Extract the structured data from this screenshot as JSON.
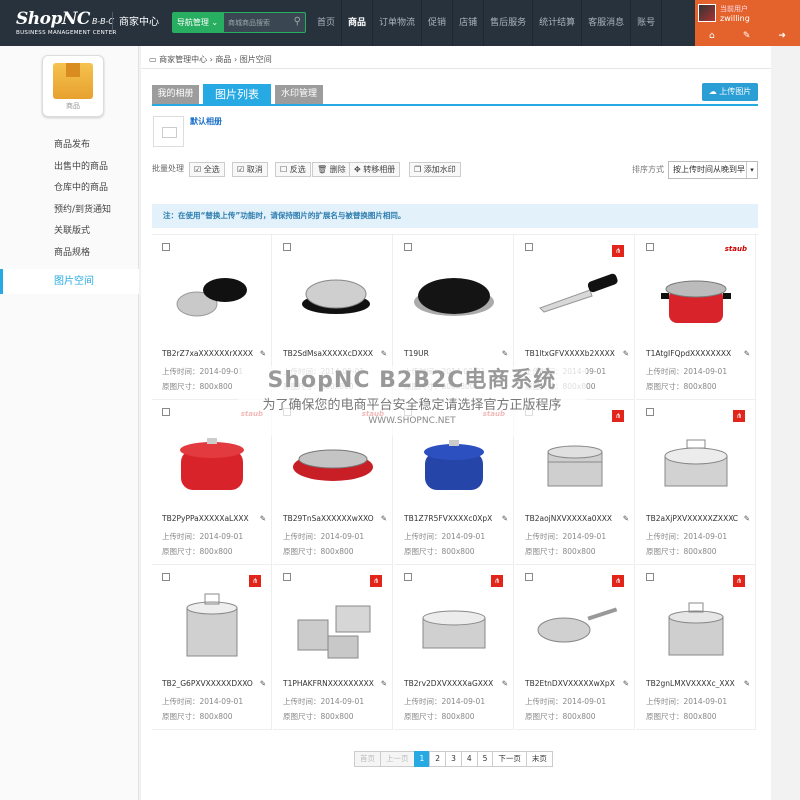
{
  "header": {
    "logo": {
      "brand": "ShopNC",
      "edition": "B-B-C",
      "tagline": "BUSINESS MANAGEMENT CENTER"
    },
    "center_title": "商家中心",
    "nav_button": "导航管理",
    "search_placeholder": "商城商品搜索",
    "nav_items": [
      "首页",
      "商品",
      "订单物流",
      "促销",
      "店铺",
      "售后服务",
      "统计结算",
      "客服消息",
      "账号"
    ],
    "user": {
      "role": "当前用户",
      "name": "zwilling",
      "icons": [
        "home-icon",
        "wrench-icon",
        "logout-icon"
      ]
    }
  },
  "sidebar": {
    "module_label": "商品",
    "items": [
      "商品发布",
      "出售中的商品",
      "仓库中的商品",
      "预约/到货通知",
      "关联版式",
      "商品规格",
      "图片空间"
    ],
    "active_index": 6
  },
  "breadcrumb": [
    "商家管理中心",
    "商品",
    "图片空间"
  ],
  "tabs": [
    "我的相册",
    "图片列表",
    "水印管理"
  ],
  "active_tab": 1,
  "upload_button": "上传图片",
  "album": {
    "name": "默认相册"
  },
  "batch": {
    "label": "批量处理",
    "buttons": [
      "全选",
      "取消",
      "反选",
      "删除",
      "转移相册",
      "添加水印"
    ]
  },
  "sort": {
    "label": "排序方式",
    "selected": "按上传时间从晚到早"
  },
  "notice": "注：在使用“替换上传”功能时，请保持图片的扩展名与被替换图片相同。",
  "photos": [
    {
      "name": "TB2rZ7xaXXXXXXrXXXX",
      "date_label": "上传时间：",
      "date": "2014-09-01",
      "size_label": "原图尺寸：",
      "size": "800x800"
    },
    {
      "name": "TB2SdMsaXXXXXcDXXX",
      "date_label": "上传时间：",
      "date": "2014-09-01",
      "size_label": "原图尺寸：",
      "size": "800x800"
    },
    {
      "name": "T19UR",
      "date_label": "上传时间：",
      "date": "2014-09-01",
      "size_label": "原图尺寸：",
      "size": "800x800"
    },
    {
      "name": "TB1ltxGFVXXXXb2XXXX",
      "date_label": "上传时间：",
      "date": "2014-09-01",
      "size_label": "原图尺寸：",
      "size": "800x800"
    },
    {
      "name": "T1AtgIFQpdXXXXXXXX",
      "date_label": "上传时间：",
      "date": "2014-09-01",
      "size_label": "原图尺寸：",
      "size": "800x800"
    },
    {
      "name": "TB2PyPPaXXXXXaLXXX",
      "date_label": "上传时间：",
      "date": "2014-09-01",
      "size_label": "原图尺寸：",
      "size": "800x800"
    },
    {
      "name": "TB29TnSaXXXXXXwXXO",
      "date_label": "上传时间：",
      "date": "2014-09-01",
      "size_label": "原图尺寸：",
      "size": "800x800"
    },
    {
      "name": "TB1Z7R5FVXXXXc0XpX",
      "date_label": "上传时间：",
      "date": "2014-09-01",
      "size_label": "原图尺寸：",
      "size": "800x800"
    },
    {
      "name": "TB2aojNXVXXXXa0XXX",
      "date_label": "上传时间：",
      "date": "2014-09-01",
      "size_label": "原图尺寸：",
      "size": "800x800"
    },
    {
      "name": "TB2aXjPXVXXXXXZXXXC",
      "date_label": "上传时间：",
      "date": "2014-09-01",
      "size_label": "原图尺寸：",
      "size": "800x800"
    },
    {
      "name": "TB2_G6PXVXXXXXDXXO",
      "date_label": "上传时间：",
      "date": "2014-09-01",
      "size_label": "原图尺寸：",
      "size": "800x800"
    },
    {
      "name": "T1PHAKFRNXXXXXXXXX",
      "date_label": "上传时间：",
      "date": "2014-09-01",
      "size_label": "原图尺寸：",
      "size": "800x800"
    },
    {
      "name": "TB2rv2DXVXXXXaGXXX",
      "date_label": "上传时间：",
      "date": "2014-09-01",
      "size_label": "原图尺寸：",
      "size": "800x800"
    },
    {
      "name": "TB2EtnDXVXXXXXwXpX",
      "date_label": "上传时间：",
      "date": "2014-09-01",
      "size_label": "原图尺寸：",
      "size": "800x800"
    },
    {
      "name": "TB2gnLMXVXXXXc_XXX",
      "date_label": "上传时间：",
      "date": "2014-09-01",
      "size_label": "原图尺寸：",
      "size": "800x800"
    }
  ],
  "pagination": {
    "first": "首页",
    "prev": "上一页",
    "pages": [
      "1",
      "2",
      "3",
      "4",
      "5"
    ],
    "current": "1",
    "next": "下一页",
    "last": "末页"
  },
  "watermark": {
    "line1": "ShopNC B2B2C电商系统",
    "line2": "为了确保您的电商平台安全稳定请选择官方正版程序",
    "line3": "WWW.SHOPNC.NET"
  },
  "colors": {
    "topbar": "#27323d",
    "accent": "#27a9e3",
    "user_box": "#e4632c",
    "nav_button": "#27ae60"
  }
}
